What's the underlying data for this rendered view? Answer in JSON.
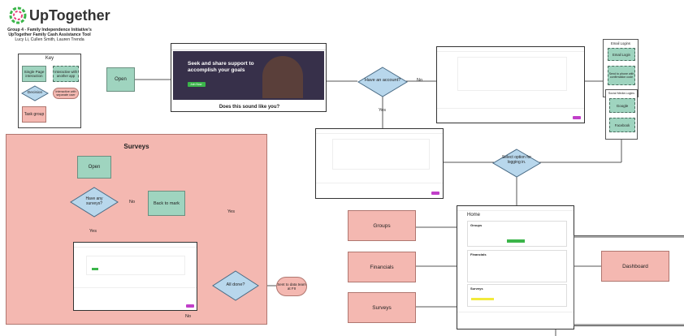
{
  "header": {
    "brand": "UpTogether",
    "line1": "Group 4 - Family Independence Initiative's",
    "line2": "UpTogether Family Cash Assistance Tool",
    "authors": "Lucy Li, Cullen Smith, Lauren Trenda"
  },
  "key": {
    "title": "Key",
    "single_page": "Single Page interaction",
    "interactive_other": "Interactive with another app",
    "decision": "Decision",
    "interactive_separate": "Interactive with separate user",
    "task_group": "Task group"
  },
  "nodes": {
    "open": "Open",
    "have_account": "Have an account?",
    "select_option": "Select option for logging in.",
    "groups": "Groups",
    "financials": "Financials",
    "surveys": "Surveys",
    "dashboard": "Dashboard"
  },
  "landing": {
    "headline1": "Seek and share support to",
    "headline2": "accomplish your goals",
    "cta": "Join Now",
    "caption": "Does this sound like you?"
  },
  "login_options": {
    "email_group_title": "Email Logins",
    "email_login": "Email Login",
    "email_confirm": "Send to phone with confirmation code",
    "social_group_title": "Social Media Logins",
    "google": "Google",
    "facebook": "Facebook"
  },
  "surveys_group": {
    "title": "Surveys",
    "open": "Open",
    "have_any": "Have any surveys?",
    "back_to_mark": "Back to mark",
    "all_done": "All done?",
    "send_to_data": "Sent to data team at FII"
  },
  "home": {
    "title": "Home",
    "groups_section": "Groups",
    "financials_section": "Financials",
    "surveys_section": "Surveys"
  },
  "edges": {
    "no": "No",
    "yes": "Yes"
  }
}
